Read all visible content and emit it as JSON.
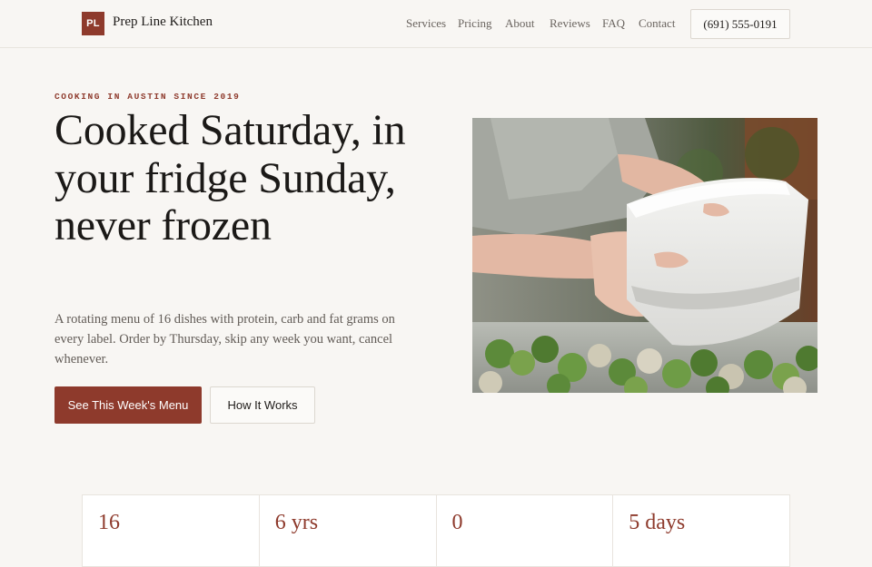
{
  "header": {
    "logo_badge": "PL",
    "brand_name": "Prep Line Kitchen",
    "nav": [
      {
        "label": "Services",
        "name": "nav-services"
      },
      {
        "label": "Pricing",
        "name": "nav-pricing"
      },
      {
        "label": "About",
        "name": "nav-about"
      },
      {
        "label": "Reviews",
        "name": "nav-reviews"
      },
      {
        "label": "FAQ",
        "name": "nav-faq"
      },
      {
        "label": "Contact",
        "name": "nav-contact"
      }
    ],
    "phone": "(691) 555-0191"
  },
  "hero": {
    "eyebrow": "COOKING IN AUSTIN SINCE 2019",
    "title": "Cooked Saturday, in your fridge Sunday, never frozen",
    "lede": "A rotating menu of 16 dishes with protein, carb and fat grams on every label. Order by Thursday, skip any week you want, cancel whenever.",
    "primary_cta": "See This Week's Menu",
    "secondary_cta": "How It Works"
  },
  "stats": [
    {
      "value": "16",
      "label": ""
    },
    {
      "value": "6 yrs",
      "label": ""
    },
    {
      "value": "0",
      "label": ""
    },
    {
      "value": "5 days",
      "label": ""
    }
  ],
  "theme": {
    "accent": "#8e3a2c",
    "background": "#f8f6f3"
  }
}
